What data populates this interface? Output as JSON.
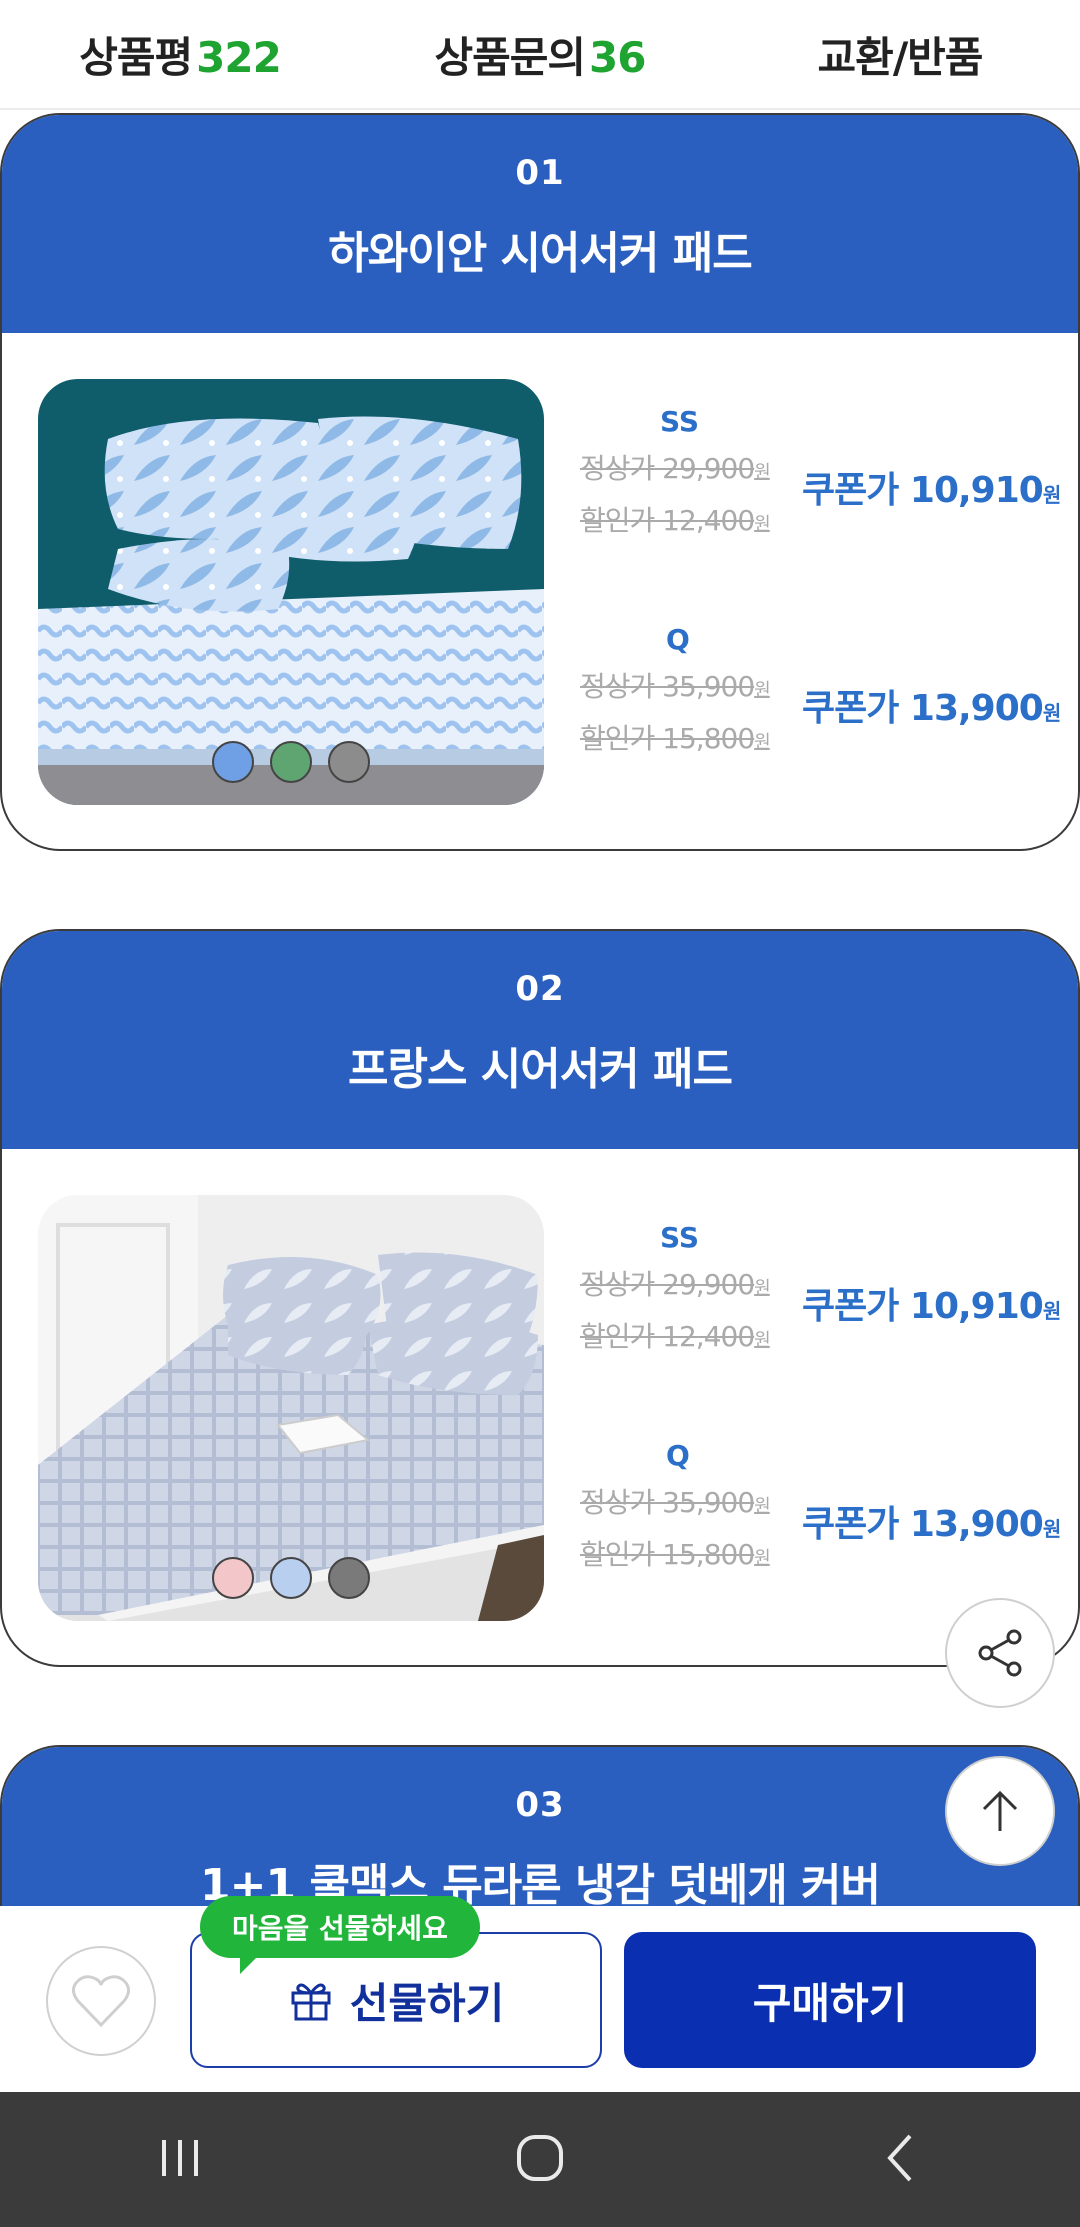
{
  "tabs": [
    {
      "label": "상품평",
      "count": "322"
    },
    {
      "label": "상품문의",
      "count": "36"
    },
    {
      "label": "교환/반품",
      "count": ""
    }
  ],
  "products": [
    {
      "num": "01",
      "title": "하와이안 시어서커 패드",
      "swatches": [
        "#6fa0e6",
        "#5fa571",
        "#8c8c8c"
      ],
      "sizes": [
        {
          "label": "SS",
          "regular": "정상가 29,900",
          "sale": "할인가 12,400",
          "coupon": "쿠폰가 10,910",
          "unit": "원"
        },
        {
          "label": "Q",
          "regular": "정상가 35,900",
          "sale": "할인가 15,800",
          "coupon": "쿠폰가 13,900",
          "unit": "원"
        }
      ]
    },
    {
      "num": "02",
      "title": "프랑스 시어서커 패드",
      "swatches": [
        "#f3c7c9",
        "#b9cfef",
        "#7a7a7a"
      ],
      "sizes": [
        {
          "label": "SS",
          "regular": "정상가 29,900",
          "sale": "할인가 12,400",
          "coupon": "쿠폰가 10,910",
          "unit": "원"
        },
        {
          "label": "Q",
          "regular": "정상가 35,900",
          "sale": "할인가 15,800",
          "coupon": "쿠폰가 13,900",
          "unit": "원"
        }
      ]
    },
    {
      "num": "03",
      "title": "1+1 쿨맥스 듀라론 냉감 덧베개 커버"
    }
  ],
  "bottom": {
    "gift_tip": "마음을 선물하세요",
    "gift_label": "선물하기",
    "buy_label": "구매하기"
  },
  "icons": {
    "share": "share-icon",
    "top": "arrow-up-icon",
    "heart": "heart-icon",
    "gift": "gift-icon"
  },
  "colors": {
    "header_blue": "#2b5fbf",
    "price_blue": "#2b6fc9",
    "count_green": "#1fa331",
    "buy_button": "#0a2fb0",
    "tip_green": "#22b53c"
  }
}
